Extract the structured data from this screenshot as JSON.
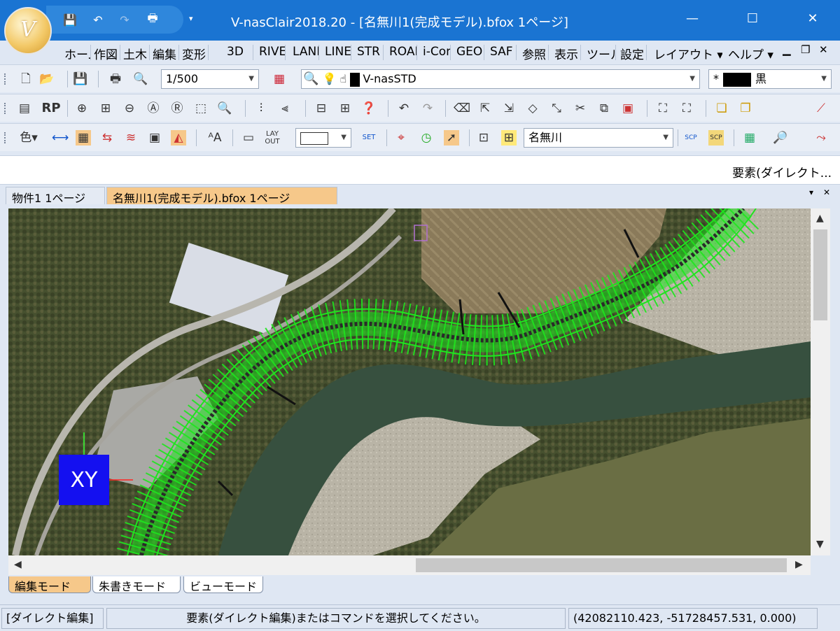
{
  "app": {
    "logo_text": "V",
    "title": "V-nasClair2018.20 - [名無川1(完成モデル).bfox 1ページ]"
  },
  "window_controls": {
    "minimize": "—",
    "maximize": "☐",
    "close": "✕"
  },
  "ribbon_tabs": [
    "ホーム",
    "作図",
    "土木",
    "編集",
    "変形",
    "3D",
    "RIVER",
    "LAND",
    "LINE",
    "STR",
    "ROAD",
    "i-Con",
    "GEO",
    "SAF",
    "参照",
    "表示",
    "ツール",
    "設定",
    "レイアウト ▾",
    "ヘルプ ▾"
  ],
  "toolbar1": {
    "scale_value": "1/500",
    "layer_value": "V-nasSTD",
    "color_prefix": "*",
    "color_value": "黒"
  },
  "toolbar2": {
    "rp_label": "RP"
  },
  "toolbar3": {
    "river_value": "名無川"
  },
  "hint": "要素(ダイレクト...",
  "doc_tabs": [
    {
      "label": "物件1 1ページ",
      "active": false
    },
    {
      "label": "名無川1(完成モデル).bfox 1ページ",
      "active": true
    }
  ],
  "viewport": {
    "xy_label": "XY"
  },
  "mode_tabs": [
    {
      "label": "編集モード",
      "active": true
    },
    {
      "label": "朱書きモード",
      "active": false
    },
    {
      "label": "ビューモード",
      "active": false
    }
  ],
  "status": {
    "mode": "[ダイレクト編集]",
    "message": "要素(ダイレクト編集)またはコマンドを選択してください。",
    "coords": "(42082110.423, -51728457.531, 0.000)"
  },
  "colors": {
    "title_blue": "#1a74d2",
    "active_tab": "#f6c88a",
    "model_green": "#1ee51e",
    "xy_box": "#1410f0"
  }
}
